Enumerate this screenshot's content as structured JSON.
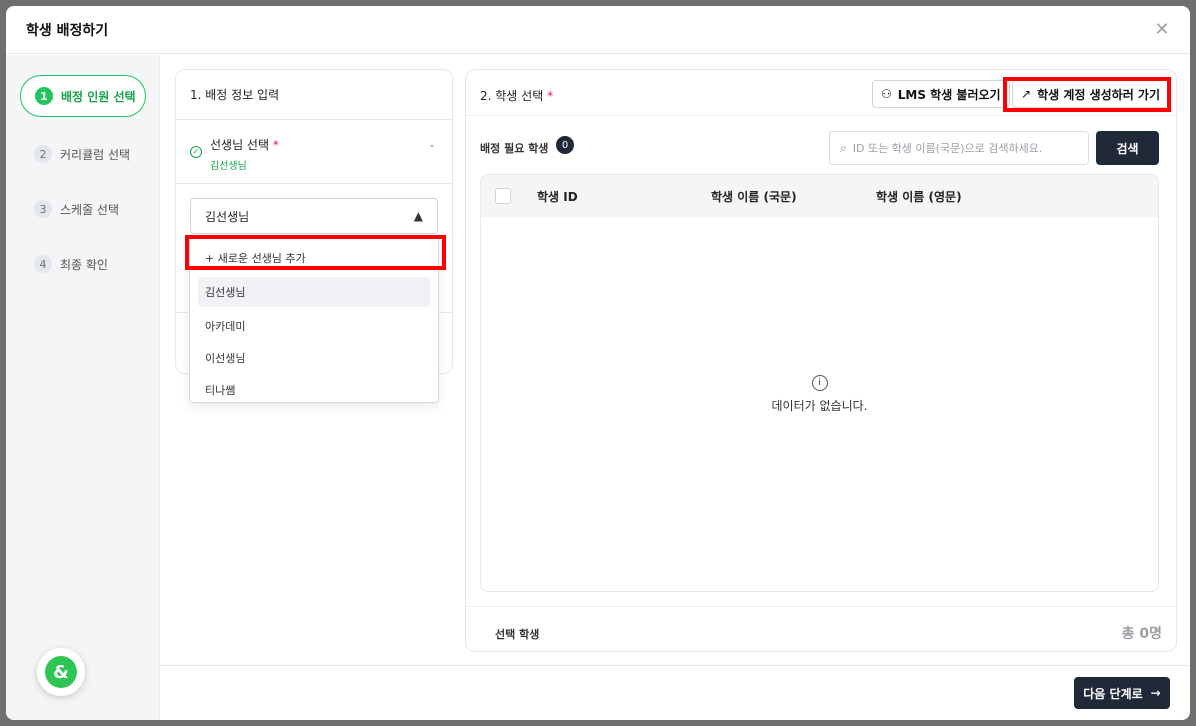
{
  "modal": {
    "title": "학생 배정하기",
    "close_icon": "close-icon"
  },
  "steps": [
    {
      "num": "1",
      "label": "배정 인원 선택",
      "active": true
    },
    {
      "num": "2",
      "label": "커리큘럼 선택"
    },
    {
      "num": "3",
      "label": "스케줄 선택"
    },
    {
      "num": "4",
      "label": "최종 확인"
    }
  ],
  "panel1": {
    "title": "1. 배정 정보 입력",
    "teacher_label": "선생님 선택",
    "required_mark": "*",
    "teacher_value": "김선생님",
    "select_value": "김선생님",
    "dropdown": {
      "add_option": "+ 새로운 선생님 추가",
      "options": [
        "김선생님",
        "아카데미",
        "이선생님",
        "티나쌤"
      ],
      "selected": "김선생님"
    }
  },
  "panel2": {
    "title": "2. 학생 선택",
    "required_mark": "*",
    "lms_button": "LMS 학생 불러오기",
    "create_button": "학생 계정 생성하러 가기",
    "need_label": "배정 필요 학생",
    "need_count": "0",
    "search_placeholder": "ID 또는 학생 이름(국문)으로 검색하세요.",
    "search_button": "검색",
    "columns": [
      "학생 ID",
      "학생 이름 (국문)",
      "학생 이름 (영문)"
    ],
    "empty_text": "데이터가 없습니다.",
    "selected_label": "선택 학생",
    "total_text": "총 0명"
  },
  "footer": {
    "next_button": "다음 단계로"
  },
  "chat": {
    "glyph": "&"
  },
  "colors": {
    "accent_green": "#22c55e",
    "dark_button": "#1f2937",
    "highlight_red": "#ff0000"
  }
}
